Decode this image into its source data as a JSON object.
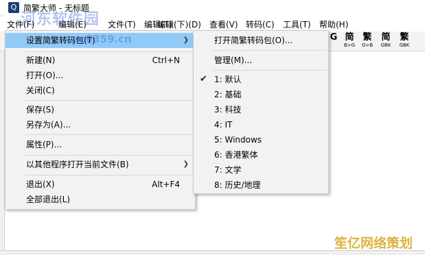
{
  "window": {
    "title": "简繁大师 - 无标题",
    "app_icon_glyph": "Q"
  },
  "watermarks": {
    "site": "河东软件园",
    "domain": "pc0359.cn",
    "corner": "笙亿网络策划"
  },
  "menubar": [
    "文件(F)",
    "编辑(E)",
    "文件(T)",
    "编辑(T)",
    "编辑(下)(D)",
    "查看(V)",
    "转码(C)",
    "工具(T)",
    "帮助(H)"
  ],
  "toolbar": [
    {
      "big": "G",
      "small": ""
    },
    {
      "big": "简",
      "small": "B>G"
    },
    {
      "big": "繁",
      "small": "G>B"
    },
    {
      "big": "简",
      "small": "GBK"
    },
    {
      "big": "繁",
      "small": "GBK"
    }
  ],
  "file_menu": {
    "items": [
      {
        "label": "设置简繁转码包(T)",
        "shortcut": "",
        "submenu": true,
        "highlighted": true
      },
      {
        "label": "新建(N)",
        "shortcut": "Ctrl+N"
      },
      {
        "label": "打开(O)...",
        "shortcut": ""
      },
      {
        "label": "关闭(C)",
        "shortcut": ""
      },
      {
        "label": "保存(S)",
        "shortcut": ""
      },
      {
        "label": "另存为(A)...",
        "shortcut": ""
      },
      {
        "label": "属性(P)...",
        "shortcut": ""
      },
      {
        "label": "以其他程序打开当前文件(B)",
        "shortcut": "",
        "submenu": true
      },
      {
        "label": "退出(X)",
        "shortcut": "Alt+F4"
      },
      {
        "label": "全部退出(L)",
        "shortcut": ""
      }
    ]
  },
  "submenu": {
    "items": [
      {
        "label": "打开简繁转码包(O)..."
      },
      {
        "label": "管理(M)..."
      },
      {
        "label": "1: 默认",
        "checked": true
      },
      {
        "label": "2: 基础"
      },
      {
        "label": "3: 科技"
      },
      {
        "label": "4: IT"
      },
      {
        "label": "5: Windows"
      },
      {
        "label": "6: 香港繁体"
      },
      {
        "label": "7: 文学"
      },
      {
        "label": "8: 历史/地理"
      }
    ]
  }
}
